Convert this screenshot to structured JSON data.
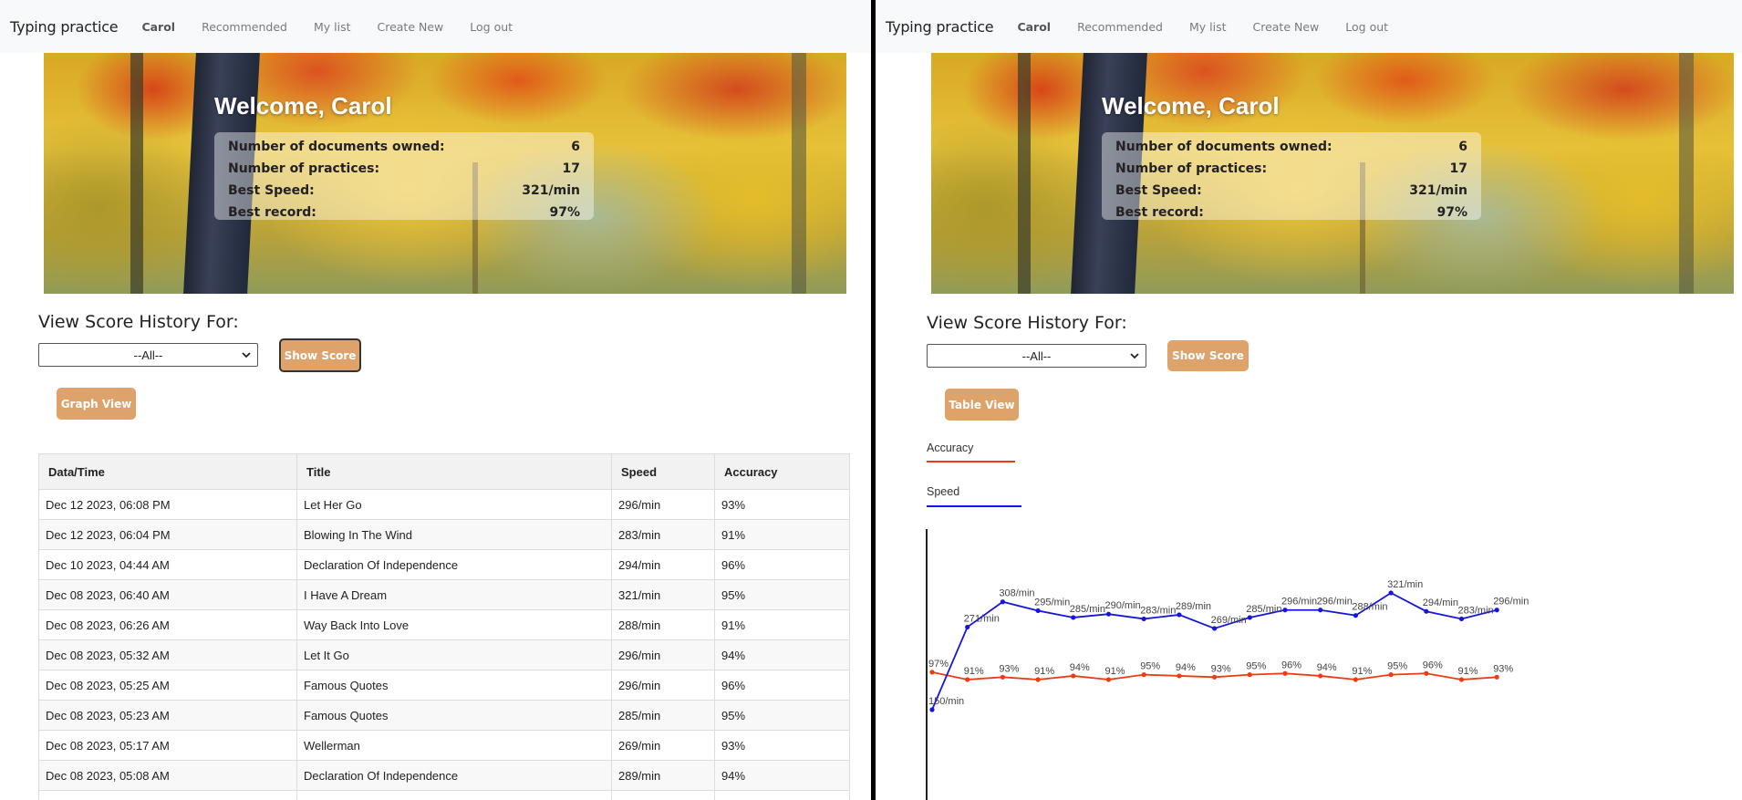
{
  "nav": {
    "brand": "Typing practice",
    "user": "Carol",
    "links": [
      "Recommended",
      "My list",
      "Create New",
      "Log out"
    ]
  },
  "hero": {
    "title": "Welcome, Carol",
    "stats": [
      {
        "label": "Number of documents owned:",
        "value": "6"
      },
      {
        "label": "Number of practices:",
        "value": "17"
      },
      {
        "label": "Best Speed:",
        "value": "321/min"
      },
      {
        "label": "Best record:",
        "value": "97%"
      }
    ]
  },
  "history": {
    "title": "View Score History For:",
    "select_value": "--All--",
    "show_button": "Show Score"
  },
  "left": {
    "view_button": "Graph View",
    "table": {
      "headers": [
        "Data/Time",
        "Title",
        "Speed",
        "Accuracy"
      ],
      "rows": [
        [
          "Dec 12 2023, 06:08 PM",
          "Let Her Go",
          "296/min",
          "93%"
        ],
        [
          "Dec 12 2023, 06:04 PM",
          "Blowing In The Wind",
          "283/min",
          "91%"
        ],
        [
          "Dec 10 2023, 04:44 AM",
          "Declaration Of Independence",
          "294/min",
          "96%"
        ],
        [
          "Dec 08 2023, 06:40 AM",
          "I Have A Dream",
          "321/min",
          "95%"
        ],
        [
          "Dec 08 2023, 06:26 AM",
          "Way Back Into Love",
          "288/min",
          "91%"
        ],
        [
          "Dec 08 2023, 05:32 AM",
          "Let It Go",
          "296/min",
          "94%"
        ],
        [
          "Dec 08 2023, 05:25 AM",
          "Famous Quotes",
          "296/min",
          "96%"
        ],
        [
          "Dec 08 2023, 05:23 AM",
          "Famous Quotes",
          "285/min",
          "95%"
        ],
        [
          "Dec 08 2023, 05:17 AM",
          "Wellerman",
          "269/min",
          "93%"
        ],
        [
          "Dec 08 2023, 05:08 AM",
          "Declaration Of Independence",
          "289/min",
          "94%"
        ],
        [
          "",
          "",
          "",
          ""
        ]
      ]
    }
  },
  "right": {
    "view_button": "Table View",
    "legend": {
      "accuracy": "Accuracy",
      "speed": "Speed"
    }
  },
  "colors": {
    "accent": "#dda36b",
    "speed": "#1515e0",
    "accuracy": "#f03a10"
  },
  "chart_data": {
    "type": "line",
    "x": [
      1,
      2,
      3,
      4,
      5,
      6,
      7,
      8,
      9,
      10,
      11,
      12,
      13,
      14,
      15,
      16,
      17
    ],
    "series": [
      {
        "name": "Speed",
        "values": [
          150,
          271,
          308,
          295,
          285,
          290,
          283,
          289,
          269,
          285,
          296,
          296,
          288,
          321,
          294,
          283,
          296
        ],
        "labels": [
          "150/min",
          "271/min",
          "308/min",
          "295/min",
          "285/min",
          "290/min",
          "283/min",
          "289/min",
          "269/min",
          "285/min",
          "296/min",
          "296/min",
          "288/min",
          "321/min",
          "294/min",
          "283/min",
          "296/min"
        ]
      },
      {
        "name": "Accuracy",
        "values": [
          97,
          91,
          93,
          91,
          94,
          91,
          95,
          94,
          93,
          95,
          96,
          94,
          91,
          95,
          96,
          91,
          93
        ],
        "labels": [
          "97%",
          "91%",
          "93%",
          "91%",
          "94%",
          "91%",
          "95%",
          "94%",
          "93%",
          "95%",
          "96%",
          "94%",
          "91%",
          "95%",
          "96%",
          "91%",
          "93%"
        ]
      }
    ]
  }
}
